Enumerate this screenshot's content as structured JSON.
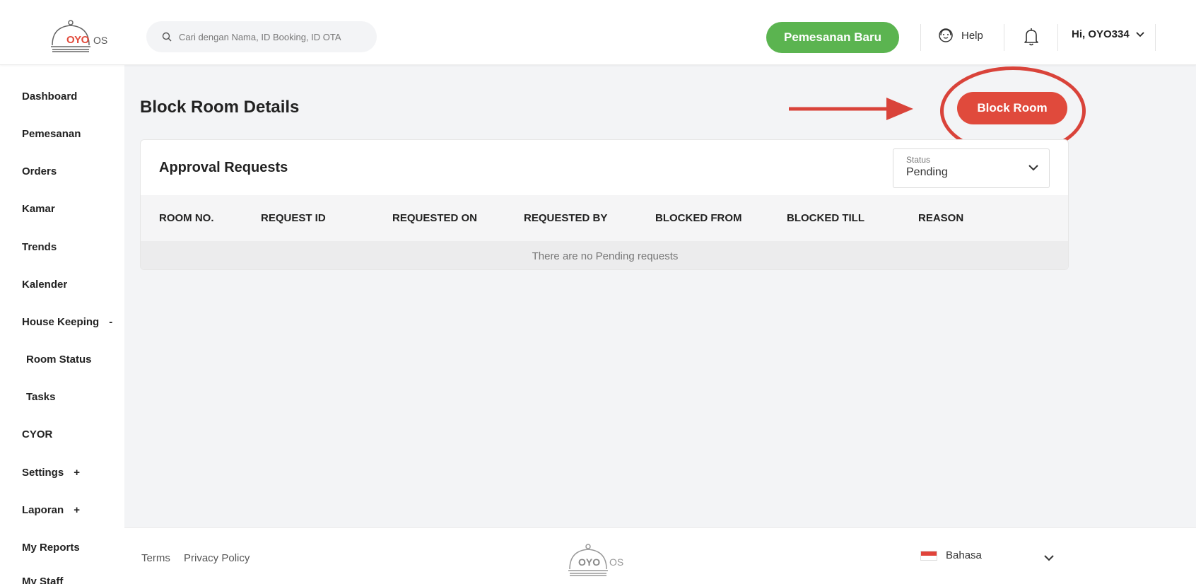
{
  "header": {
    "logo_text": "OYO",
    "logo_suffix": "OS",
    "search_placeholder": "Cari dengan Nama, ID Booking, ID OTA",
    "new_booking_label": "Pemesanan Baru",
    "help_label": "Help",
    "user_label": "Hi, OYO334"
  },
  "sidebar": {
    "items": [
      {
        "label": "Dashboard",
        "suffix": ""
      },
      {
        "label": "Pemesanan",
        "suffix": ""
      },
      {
        "label": "Orders",
        "suffix": ""
      },
      {
        "label": "Kamar",
        "suffix": ""
      },
      {
        "label": "Trends",
        "suffix": ""
      },
      {
        "label": "Kalender",
        "suffix": ""
      },
      {
        "label": "House Keeping",
        "suffix": "-"
      },
      {
        "label": "Room Status",
        "suffix": ""
      },
      {
        "label": "Tasks",
        "suffix": ""
      },
      {
        "label": "CYOR",
        "suffix": ""
      },
      {
        "label": "Settings",
        "suffix": "+"
      },
      {
        "label": "Laporan",
        "suffix": "+"
      },
      {
        "label": "My Reports",
        "suffix": ""
      },
      {
        "label": "My Staff",
        "suffix": ""
      }
    ]
  },
  "main": {
    "title": "Block Room Details",
    "block_room_label": "Block Room",
    "card_title": "Approval Requests",
    "status_label": "Status",
    "status_value": "Pending",
    "columns": [
      "ROOM NO.",
      "REQUEST ID",
      "REQUESTED ON",
      "REQUESTED BY",
      "BLOCKED FROM",
      "BLOCKED TILL",
      "REASON"
    ],
    "empty_message": "There are no Pending requests"
  },
  "footer": {
    "terms_label": "Terms",
    "privacy_label": "Privacy Policy",
    "logo_text": "OYO",
    "logo_suffix": "OS",
    "language_label": "Bahasa"
  },
  "colors": {
    "accent_green": "#5bb450",
    "accent_red": "#e04a3c",
    "annotation_red": "#d9433a"
  }
}
